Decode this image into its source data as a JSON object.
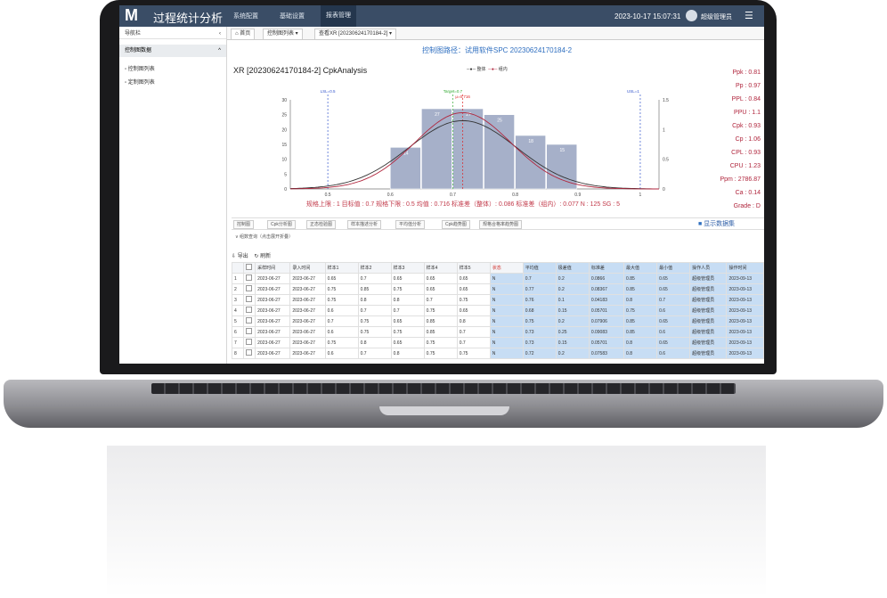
{
  "app": {
    "logo_letter": "M",
    "title": "过程统计分析"
  },
  "nav": [
    {
      "label": "系统配置"
    },
    {
      "label": "基础设置"
    },
    {
      "label": "报表管理"
    }
  ],
  "header": {
    "clock": "2023-10-17 15:07:31",
    "user": "超级管理员"
  },
  "sidebar": {
    "head": "导航栏",
    "group": "控制图数据",
    "items": [
      {
        "label": "控制图列表"
      },
      {
        "label": "定制图列表"
      }
    ]
  },
  "tabs": [
    {
      "label": "首页"
    },
    {
      "label": "控制图列表"
    },
    {
      "label": "查看XR [20230624170184-2]"
    }
  ],
  "breadcrumb": "控制图路径：试用软件SPC   20230624170184-2",
  "chart_title": "XR [20230624170184-2] CpkAnalysis",
  "stats": [
    {
      "label": "Ppk : 0.81"
    },
    {
      "label": "Pp : 0.97"
    },
    {
      "label": "PPL : 0.84"
    },
    {
      "label": "PPU : 1.1"
    },
    {
      "label": "Cpk : 0.93"
    },
    {
      "label": "Cp : 1.06"
    },
    {
      "label": "CPL : 0.93"
    },
    {
      "label": "CPU : 1.23"
    },
    {
      "label": "Ppm : 2786.87"
    },
    {
      "label": "Ca : 0.14"
    },
    {
      "label": "Grade : D"
    }
  ],
  "infoline": "规格上限 : 1   目标值 : 0.7   规格下限 : 0.5   均值 : 0.716   标准差（整体）: 0.086   标准差（组内）: 0.077   N : 125   SG : 5",
  "toolbar": [
    {
      "label": "控制图"
    },
    {
      "label": "Cpk分析图"
    },
    {
      "label": "正态检验图"
    },
    {
      "label": "样本描述分析"
    },
    {
      "label": "平均值分析"
    },
    {
      "label": "Cpk趋势图"
    },
    {
      "label": "规格合格率趋势图"
    }
  ],
  "show_data": "显示数据集",
  "collapse_label": "∨ 组数查询（点击展开折叠）",
  "ops": {
    "export": "导出",
    "refresh": "刷新"
  },
  "chart_data": {
    "type": "bar",
    "title": "XR [20230624170184-2] CpkAnalysis",
    "legend": [
      "整体",
      "组内"
    ],
    "x_ticks": [
      0.5,
      0.6,
      0.7,
      0.8,
      0.9,
      1
    ],
    "bins": [
      {
        "x0": 0.6,
        "x1": 0.65,
        "count": 14
      },
      {
        "x0": 0.65,
        "x1": 0.7,
        "count": 27
      },
      {
        "x0": 0.7,
        "x1": 0.75,
        "count": 27
      },
      {
        "x0": 0.75,
        "x1": 0.8,
        "count": 25
      },
      {
        "x0": 0.8,
        "x1": 0.85,
        "count": 18
      },
      {
        "x0": 0.85,
        "x1": 0.9,
        "count": 15
      }
    ],
    "ylim_left": [
      0,
      30
    ],
    "y_ticks_left": [
      0,
      5,
      10,
      15,
      20,
      25,
      30
    ],
    "ylim_right": [
      0,
      1.5
    ],
    "y_ticks_right": [
      0,
      0.5,
      1,
      1.5
    ],
    "mean": 0.716,
    "sd_overall": 0.086,
    "sd_within": 0.077,
    "ref_lines": [
      {
        "x": 0.5,
        "label": "LSL=0.5",
        "color": "#3355cc"
      },
      {
        "x": 0.7,
        "label": "Target=0.7",
        "color": "#33aa33"
      },
      {
        "x": 0.716,
        "label": "μ=0.716",
        "color": "#dd2222"
      },
      {
        "x": 1,
        "label": "USL=1",
        "color": "#3355cc"
      }
    ]
  },
  "table": {
    "headers": [
      "",
      "",
      "采样时间",
      "录入时间",
      "样本1",
      "样本2",
      "样本3",
      "样本4",
      "样本5",
      "状态",
      "平均值",
      "极差值",
      "标准差",
      "最大值",
      "最小值",
      "操作人员",
      "操作时间"
    ],
    "rows": [
      [
        "1",
        "2023-06-27",
        "2023-06-27",
        "0.65",
        "0.7",
        "0.65",
        "0.65",
        "0.65",
        "N",
        "0.7",
        "0.2",
        "0.0866",
        "0.85",
        "0.65",
        "超级管理员",
        "2023-09-13"
      ],
      [
        "2",
        "2023-06-27",
        "2023-06-27",
        "0.75",
        "0.85",
        "0.75",
        "0.65",
        "0.65",
        "N",
        "0.77",
        "0.2",
        "0.08367",
        "0.85",
        "0.65",
        "超级管理员",
        "2023-09-13"
      ],
      [
        "3",
        "2023-06-27",
        "2023-06-27",
        "0.75",
        "0.8",
        "0.8",
        "0.7",
        "0.75",
        "N",
        "0.76",
        "0.1",
        "0.04183",
        "0.8",
        "0.7",
        "超级管理员",
        "2023-09-13"
      ],
      [
        "4",
        "2023-06-27",
        "2023-06-27",
        "0.6",
        "0.7",
        "0.7",
        "0.75",
        "0.65",
        "N",
        "0.68",
        "0.15",
        "0.05701",
        "0.75",
        "0.6",
        "超级管理员",
        "2023-09-13"
      ],
      [
        "5",
        "2023-06-27",
        "2023-06-27",
        "0.7",
        "0.75",
        "0.65",
        "0.85",
        "0.8",
        "N",
        "0.75",
        "0.2",
        "0.07906",
        "0.85",
        "0.65",
        "超级管理员",
        "2023-09-13"
      ],
      [
        "6",
        "2023-06-27",
        "2023-06-27",
        "0.6",
        "0.75",
        "0.75",
        "0.85",
        "0.7",
        "N",
        "0.73",
        "0.25",
        "0.09083",
        "0.85",
        "0.6",
        "超级管理员",
        "2023-09-13"
      ],
      [
        "7",
        "2023-06-27",
        "2023-06-27",
        "0.75",
        "0.8",
        "0.65",
        "0.75",
        "0.7",
        "N",
        "0.73",
        "0.15",
        "0.05701",
        "0.8",
        "0.65",
        "超级管理员",
        "2023-09-13"
      ],
      [
        "8",
        "2023-06-27",
        "2023-06-27",
        "0.6",
        "0.7",
        "0.8",
        "0.75",
        "0.75",
        "N",
        "0.72",
        "0.2",
        "0.07583",
        "0.8",
        "0.6",
        "超级管理员",
        "2023-09-13"
      ]
    ]
  }
}
